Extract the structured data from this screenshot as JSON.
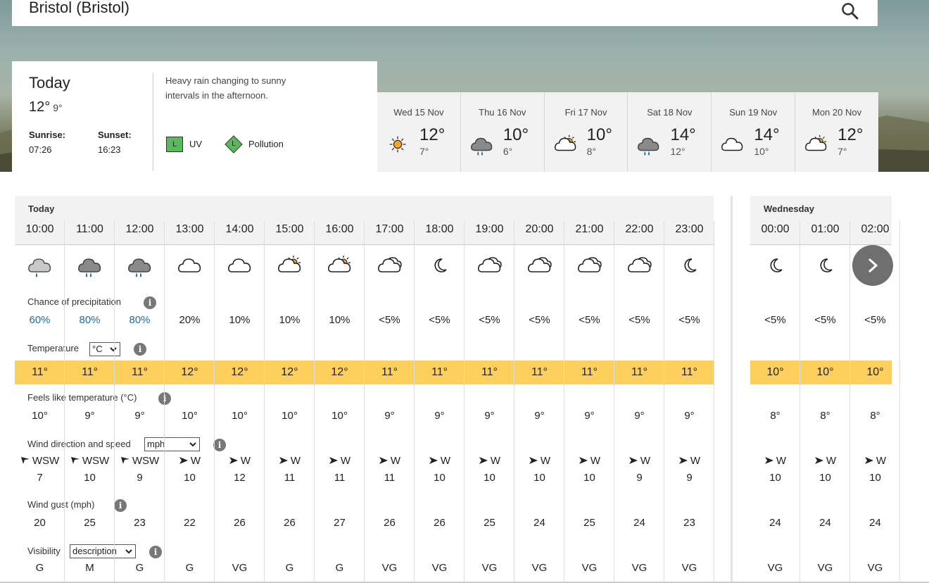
{
  "location": "Bristol (Bristol)",
  "today": {
    "label": "Today",
    "high": "12°",
    "low": "9°",
    "sunrise_label": "Sunrise:",
    "sunrise": "07:26",
    "sunset_label": "Sunset:",
    "sunset": "16:23",
    "description": "Heavy rain changing to sunny intervals in the afternoon.",
    "uv_level": "L",
    "uv_label": "UV",
    "pollution_level": "L",
    "pollution_label": "Pollution"
  },
  "days": [
    {
      "name": "Wed 15 Nov",
      "high": "12°",
      "low": "7°",
      "icon": "sun-icon"
    },
    {
      "name": "Thu 16 Nov",
      "high": "10°",
      "low": "6°",
      "icon": "rain-cloud-icon"
    },
    {
      "name": "Fri 17 Nov",
      "high": "10°",
      "low": "8°",
      "icon": "sunny-intervals-icon"
    },
    {
      "name": "Sat 18 Nov",
      "high": "14°",
      "low": "12°",
      "icon": "rain-cloud-icon"
    },
    {
      "name": "Sun 19 Nov",
      "high": "14°",
      "low": "10°",
      "icon": "cloud-icon"
    },
    {
      "name": "Mon 20 Nov",
      "high": "12°",
      "low": "7°",
      "icon": "sunny-intervals-icon"
    }
  ],
  "labels": {
    "today": "Today",
    "wednesday": "Wednesday",
    "precip": "Chance of precipitation",
    "temperature": "Temperature",
    "temp_unit": "°C",
    "feels": "Feels like temperature (°C)",
    "wind": "Wind direction and speed",
    "wind_unit": "mph",
    "gust": "Wind gust (mph)",
    "visibility": "Visibility",
    "vis_mode": "description",
    "info": "i"
  },
  "hours": [
    {
      "time": "10:00",
      "icon": "light-rain-icon",
      "precip": "60%",
      "temp": "11°",
      "feels": "10°",
      "dir": "WSW",
      "speed": "7",
      "gust": "20",
      "vis": "G"
    },
    {
      "time": "11:00",
      "icon": "heavy-rain-icon",
      "precip": "80%",
      "temp": "11°",
      "feels": "9°",
      "dir": "WSW",
      "speed": "10",
      "gust": "25",
      "vis": "M"
    },
    {
      "time": "12:00",
      "icon": "heavy-rain-icon",
      "precip": "80%",
      "temp": "11°",
      "feels": "9°",
      "dir": "WSW",
      "speed": "9",
      "gust": "23",
      "vis": "G"
    },
    {
      "time": "13:00",
      "icon": "cloud-icon",
      "precip": "20%",
      "temp": "12°",
      "feels": "10°",
      "dir": "W",
      "speed": "10",
      "gust": "22",
      "vis": "G"
    },
    {
      "time": "14:00",
      "icon": "cloud-icon",
      "precip": "10%",
      "temp": "12°",
      "feels": "10°",
      "dir": "W",
      "speed": "12",
      "gust": "26",
      "vis": "VG"
    },
    {
      "time": "15:00",
      "icon": "sunny-intervals-icon",
      "precip": "10%",
      "temp": "12°",
      "feels": "10°",
      "dir": "W",
      "speed": "11",
      "gust": "26",
      "vis": "G"
    },
    {
      "time": "16:00",
      "icon": "sunny-intervals-icon",
      "precip": "10%",
      "temp": "12°",
      "feels": "10°",
      "dir": "W",
      "speed": "11",
      "gust": "27",
      "vis": "G"
    },
    {
      "time": "17:00",
      "icon": "cloudy-icon",
      "precip": "<5%",
      "temp": "11°",
      "feels": "9°",
      "dir": "W",
      "speed": "11",
      "gust": "26",
      "vis": "VG"
    },
    {
      "time": "18:00",
      "icon": "clear-night-icon",
      "precip": "<5%",
      "temp": "11°",
      "feels": "9°",
      "dir": "W",
      "speed": "10",
      "gust": "26",
      "vis": "VG"
    },
    {
      "time": "19:00",
      "icon": "cloudy-icon",
      "precip": "<5%",
      "temp": "11°",
      "feels": "9°",
      "dir": "W",
      "speed": "10",
      "gust": "25",
      "vis": "VG"
    },
    {
      "time": "20:00",
      "icon": "cloudy-icon",
      "precip": "<5%",
      "temp": "11°",
      "feels": "9°",
      "dir": "W",
      "speed": "10",
      "gust": "24",
      "vis": "VG"
    },
    {
      "time": "21:00",
      "icon": "cloudy-icon",
      "precip": "<5%",
      "temp": "11°",
      "feels": "9°",
      "dir": "W",
      "speed": "10",
      "gust": "25",
      "vis": "VG"
    },
    {
      "time": "22:00",
      "icon": "cloudy-icon",
      "precip": "<5%",
      "temp": "11°",
      "feels": "9°",
      "dir": "W",
      "speed": "9",
      "gust": "24",
      "vis": "VG"
    },
    {
      "time": "23:00",
      "icon": "clear-night-icon",
      "precip": "<5%",
      "temp": "11°",
      "feels": "9°",
      "dir": "W",
      "speed": "9",
      "gust": "23",
      "vis": "VG"
    },
    {
      "time": "00:00",
      "icon": "clear-night-icon",
      "precip": "<5%",
      "temp": "10°",
      "feels": "8°",
      "dir": "W",
      "speed": "10",
      "gust": "24",
      "vis": "VG"
    },
    {
      "time": "01:00",
      "icon": "clear-night-icon",
      "precip": "<5%",
      "temp": "10°",
      "feels": "8°",
      "dir": "W",
      "speed": "10",
      "gust": "24",
      "vis": "VG"
    },
    {
      "time": "02:00",
      "icon": "clear-night-icon",
      "precip": "<5%",
      "temp": "10°",
      "feels": "8°",
      "dir": "W",
      "speed": "10",
      "gust": "24",
      "vis": "VG"
    }
  ],
  "colors": {
    "temp_band": "#fdd05e",
    "precip_high": "#1f6aa5",
    "sun": "#f5a623",
    "uv_badge": "#5cb85c"
  }
}
